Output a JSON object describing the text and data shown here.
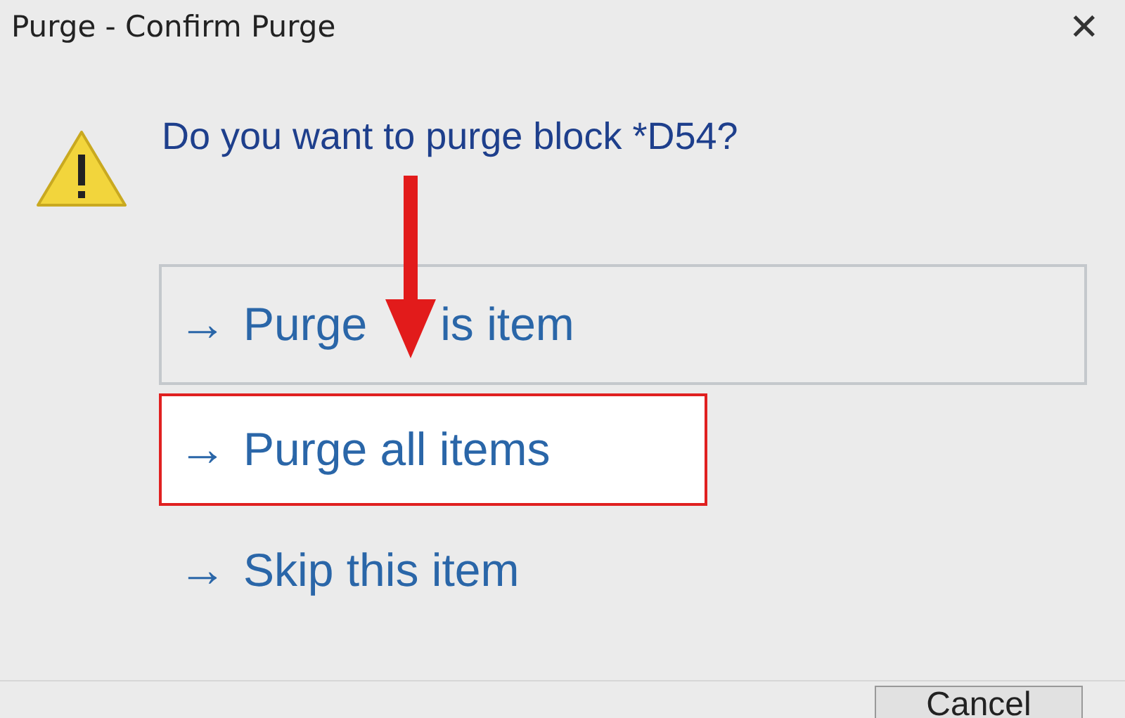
{
  "window": {
    "title": "Purge - Confirm Purge",
    "close": "✕"
  },
  "question": "Do you want to purge block *D54?",
  "options": [
    {
      "arrow": "→",
      "labels": [
        "Purge",
        "is item"
      ],
      "outlined": true,
      "selected": false
    },
    {
      "arrow": "→",
      "labels": [
        "Purge all items"
      ],
      "outlined": false,
      "selected": true
    },
    {
      "arrow": "→",
      "labels": [
        "Skip this item"
      ],
      "outlined": false,
      "selected": false
    }
  ],
  "buttons": [
    "Cancel"
  ]
}
